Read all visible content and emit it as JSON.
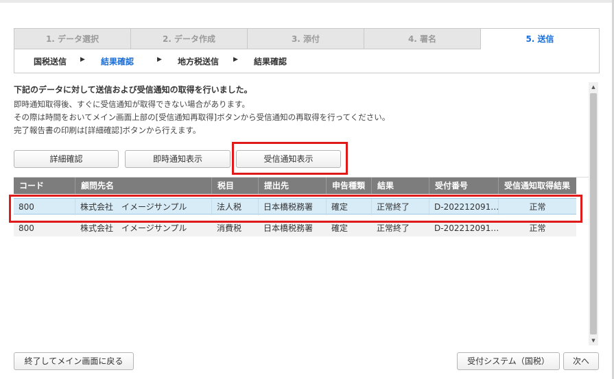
{
  "steps": {
    "tabs": [
      {
        "label": "1. データ選択",
        "active": false
      },
      {
        "label": "2. データ作成",
        "active": false
      },
      {
        "label": "3. 添付",
        "active": false
      },
      {
        "label": "4. 署名",
        "active": false
      },
      {
        "label": "5. 送信",
        "active": true
      }
    ],
    "substeps": [
      "国税送信",
      "結果確認",
      "地方税送信",
      "結果確認"
    ],
    "active_substep": 1
  },
  "message": {
    "heading": "下記のデータに対して送信および受信通知の取得を行いました。",
    "lines": [
      "即時通知取得後、すぐに受信通知が取得できない場合があります。",
      "その際は時間をおいてメイン画面上部の[受信通知再取得]ボタンから受信通知の再取得を行ってください。",
      "完了報告書の印刷は[詳細確認]ボタンから行えます。"
    ]
  },
  "actions": {
    "detail": "詳細確認",
    "immediate": "即時通知表示",
    "receipt": "受信通知表示"
  },
  "table": {
    "columns": [
      "コード",
      "顧問先名",
      "税目",
      "提出先",
      "申告種類",
      "結果",
      "受付番号",
      "受信通知取得結果"
    ],
    "rows": [
      [
        "800",
        "株式会社　イメージサンプル",
        "法人税",
        "日本橋税務署",
        "確定",
        "正常終了",
        "D-202212091…",
        "正常"
      ],
      [
        "800",
        "株式会社　イメージサンプル",
        "消費税",
        "日本橋税務署",
        "確定",
        "正常終了",
        "D-202212091…",
        "正常"
      ]
    ],
    "selected_row": 0
  },
  "footer": {
    "end": "終了してメイン画面に戻る",
    "reception_system": "受付システム（国税）",
    "next": "次へ"
  },
  "colors": {
    "accent": "#1a6fd8",
    "highlight": "#e01919",
    "header_bg": "#7d7d7d",
    "selected_row": "#d8ecf8"
  },
  "icons": {
    "substep_arrow": "right-triangle-icon",
    "scroll_up": "scroll-up-arrow-icon",
    "scroll_down": "scroll-down-arrow-icon"
  }
}
